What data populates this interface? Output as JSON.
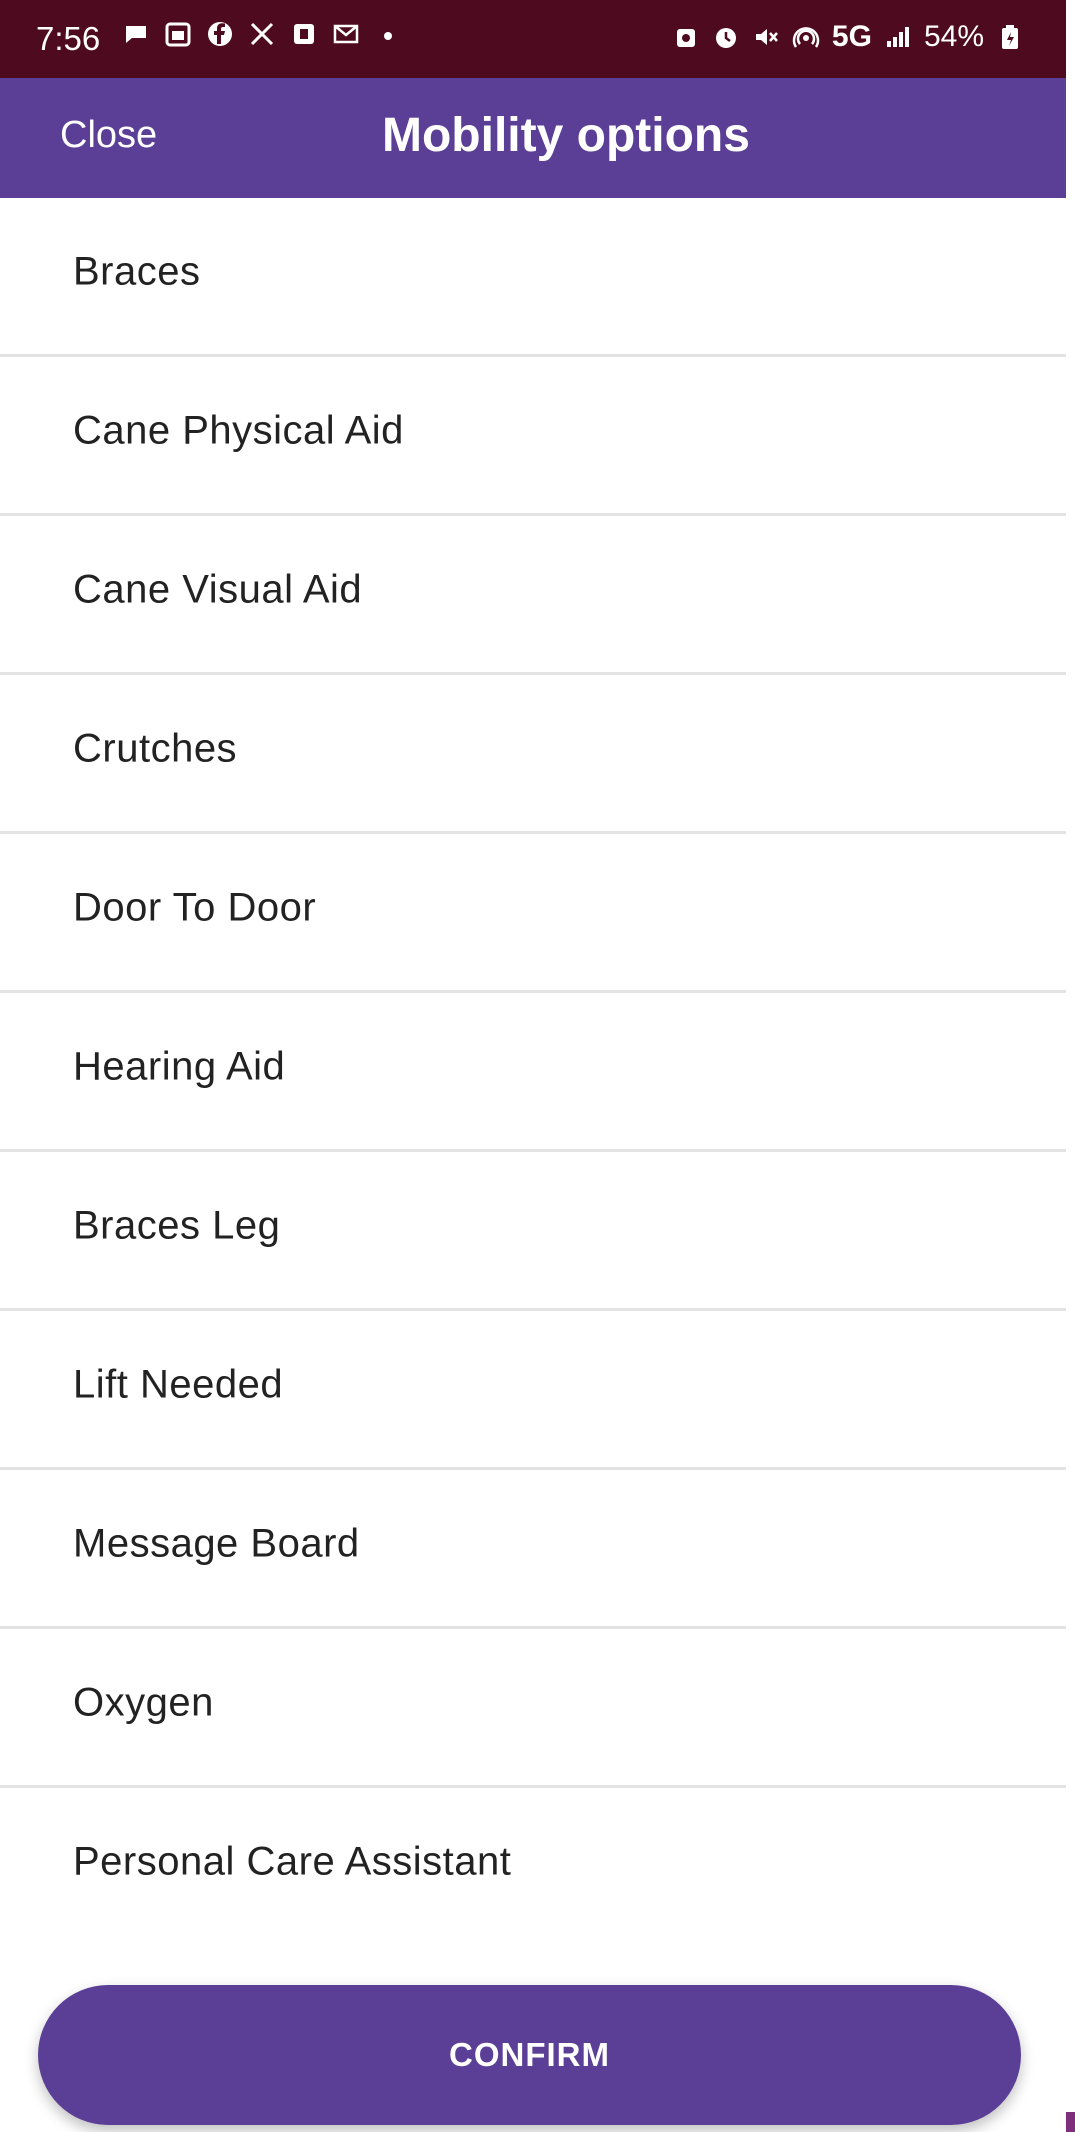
{
  "status_bar": {
    "time": "7:56",
    "network": "5G",
    "battery": "54%",
    "left_icons": [
      "chat-icon",
      "calendar-icon",
      "facebook-icon",
      "x-icon",
      "notification-icon",
      "gmail-icon",
      "dot-icon"
    ],
    "right_icons": [
      "battery-saver-icon",
      "alarm-icon",
      "mute-icon",
      "hotspot-icon",
      "signal-icon",
      "battery-icon"
    ]
  },
  "header": {
    "close_label": "Close",
    "title": "Mobility options"
  },
  "options": [
    {
      "label": "Braces"
    },
    {
      "label": "Cane Physical Aid"
    },
    {
      "label": "Cane Visual Aid"
    },
    {
      "label": "Crutches"
    },
    {
      "label": "Door To Door"
    },
    {
      "label": "Hearing Aid"
    },
    {
      "label": "Braces Leg"
    },
    {
      "label": "Lift Needed"
    },
    {
      "label": "Message Board"
    },
    {
      "label": "Oxygen"
    },
    {
      "label": "Personal Care Assistant"
    }
  ],
  "confirm_label": "CONFIRM",
  "colors": {
    "status_bar": "#4e0b1f",
    "accent": "#5b3f96",
    "divider": "#e3e3e3",
    "text": "#222222"
  }
}
